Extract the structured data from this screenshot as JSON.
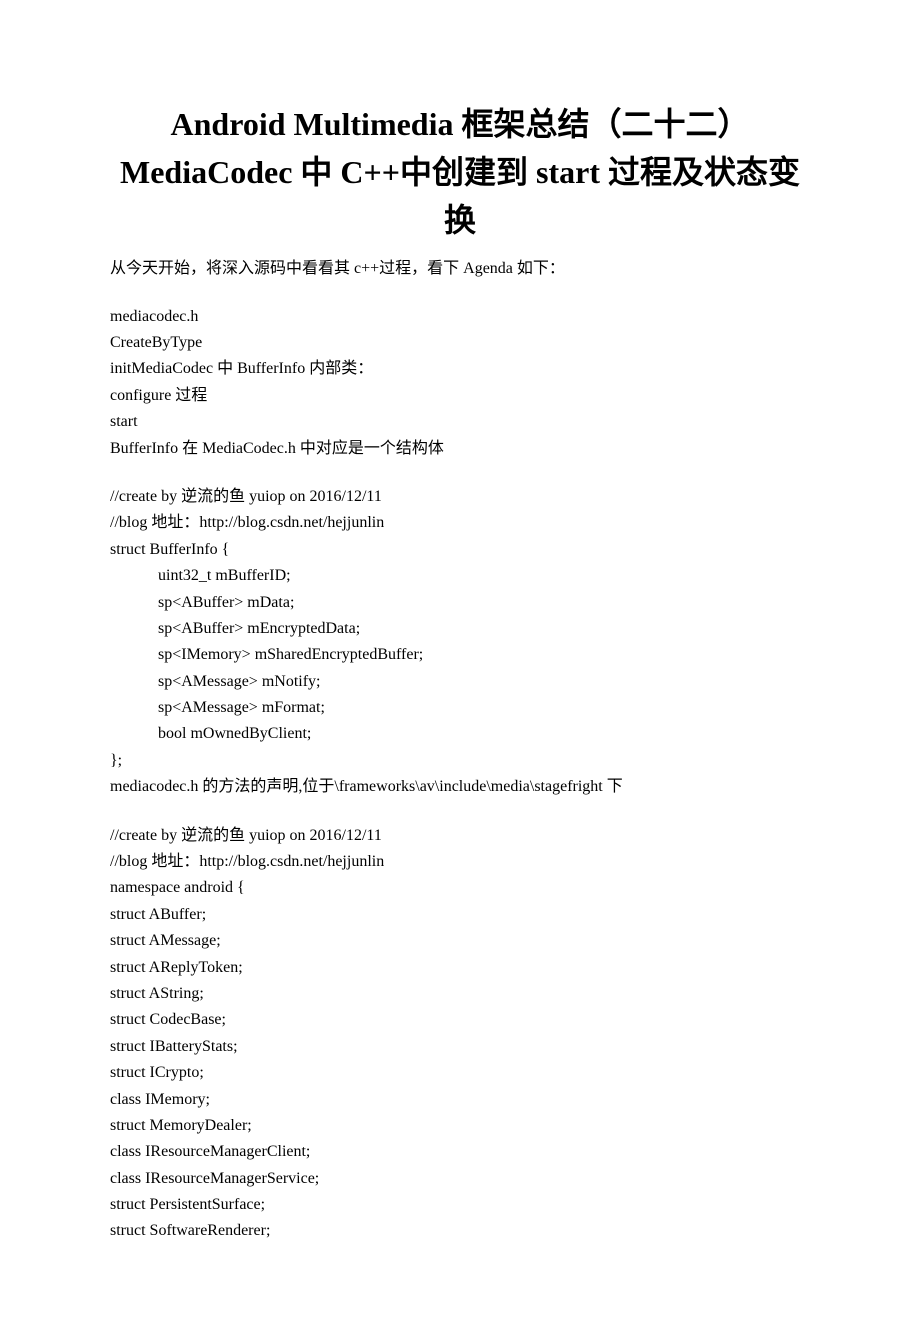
{
  "title": "Android Multimedia 框架总结（二十二）MediaCodec 中 C++中创建到 start 过程及状态变换",
  "intro": "从今天开始，将深入源码中看看其 c++过程，看下 Agenda 如下：",
  "block1": "mediacodec.h\nCreateByType\ninitMediaCodec 中 BufferInfo 内部类：\nconfigure 过程\nstart\nBufferInfo 在 MediaCodec.h 中对应是一个结构体",
  "block2": "//create by 逆流的鱼 yuiop on 2016/12/11\n//blog 地址：http://blog.csdn.net/hejjunlin\nstruct BufferInfo {\n            uint32_t mBufferID;\n            sp<ABuffer> mData;\n            sp<ABuffer> mEncryptedData;\n            sp<IMemory> mSharedEncryptedBuffer;\n            sp<AMessage> mNotify;\n            sp<AMessage> mFormat;\n            bool mOwnedByClient;\n};\nmediacodec.h 的方法的声明,位于\\frameworks\\av\\include\\media\\stagefright 下",
  "block3": "//create by 逆流的鱼 yuiop on 2016/12/11\n//blog 地址：http://blog.csdn.net/hejjunlin\nnamespace android {\nstruct ABuffer;\nstruct AMessage;\nstruct AReplyToken;\nstruct AString;\nstruct CodecBase;\nstruct IBatteryStats;\nstruct ICrypto;\nclass IMemory;\nstruct MemoryDealer;\nclass IResourceManagerClient;\nclass IResourceManagerService;\nstruct PersistentSurface;\nstruct SoftwareRenderer;"
}
